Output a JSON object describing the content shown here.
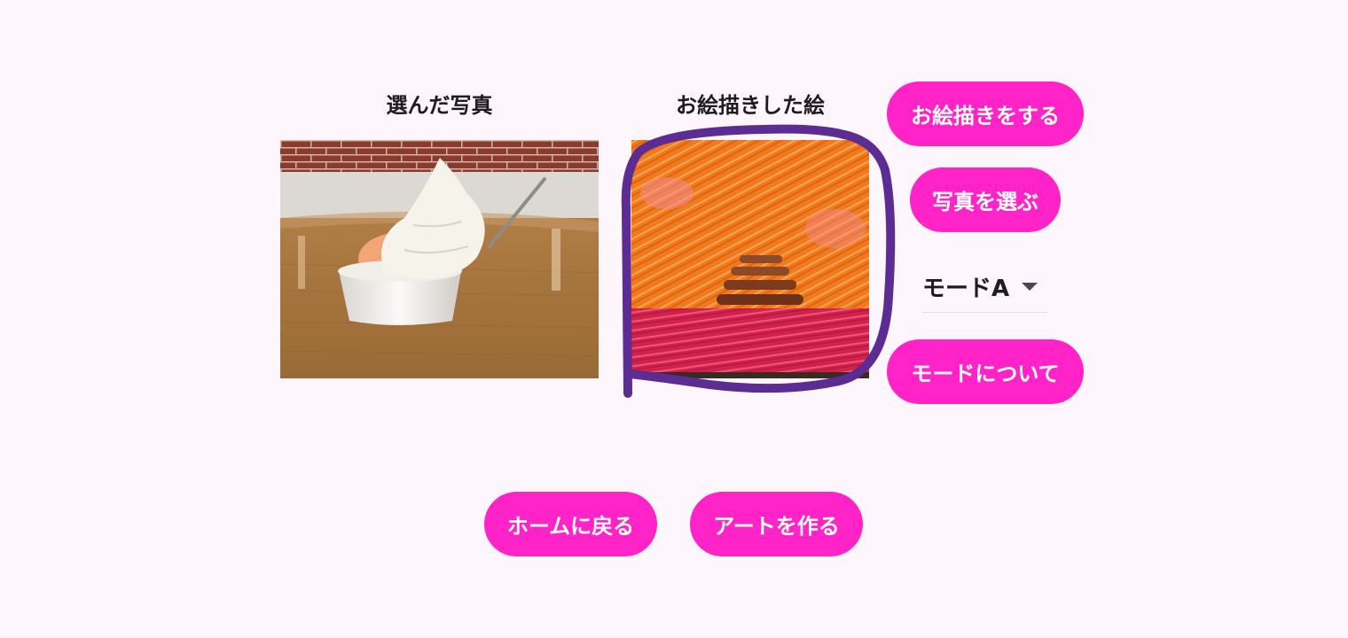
{
  "photo_panel": {
    "title": "選んだ写真"
  },
  "drawing_panel": {
    "title": "お絵描きした絵"
  },
  "side_controls": {
    "draw_button": "お絵描きをする",
    "choose_photo_button": "写真を選ぶ",
    "mode_select": {
      "selected": "モードA",
      "icon": "dropdown-arrow-icon"
    },
    "about_mode_button": "モードについて"
  },
  "bottom_actions": {
    "home_button": "ホームに戻る",
    "make_art_button": "アートを作る"
  },
  "colors": {
    "button_bg": "#ff23c8",
    "button_text": "#ffffff",
    "background": "#fdf6fd",
    "outline_stroke": "#5c2c93"
  }
}
